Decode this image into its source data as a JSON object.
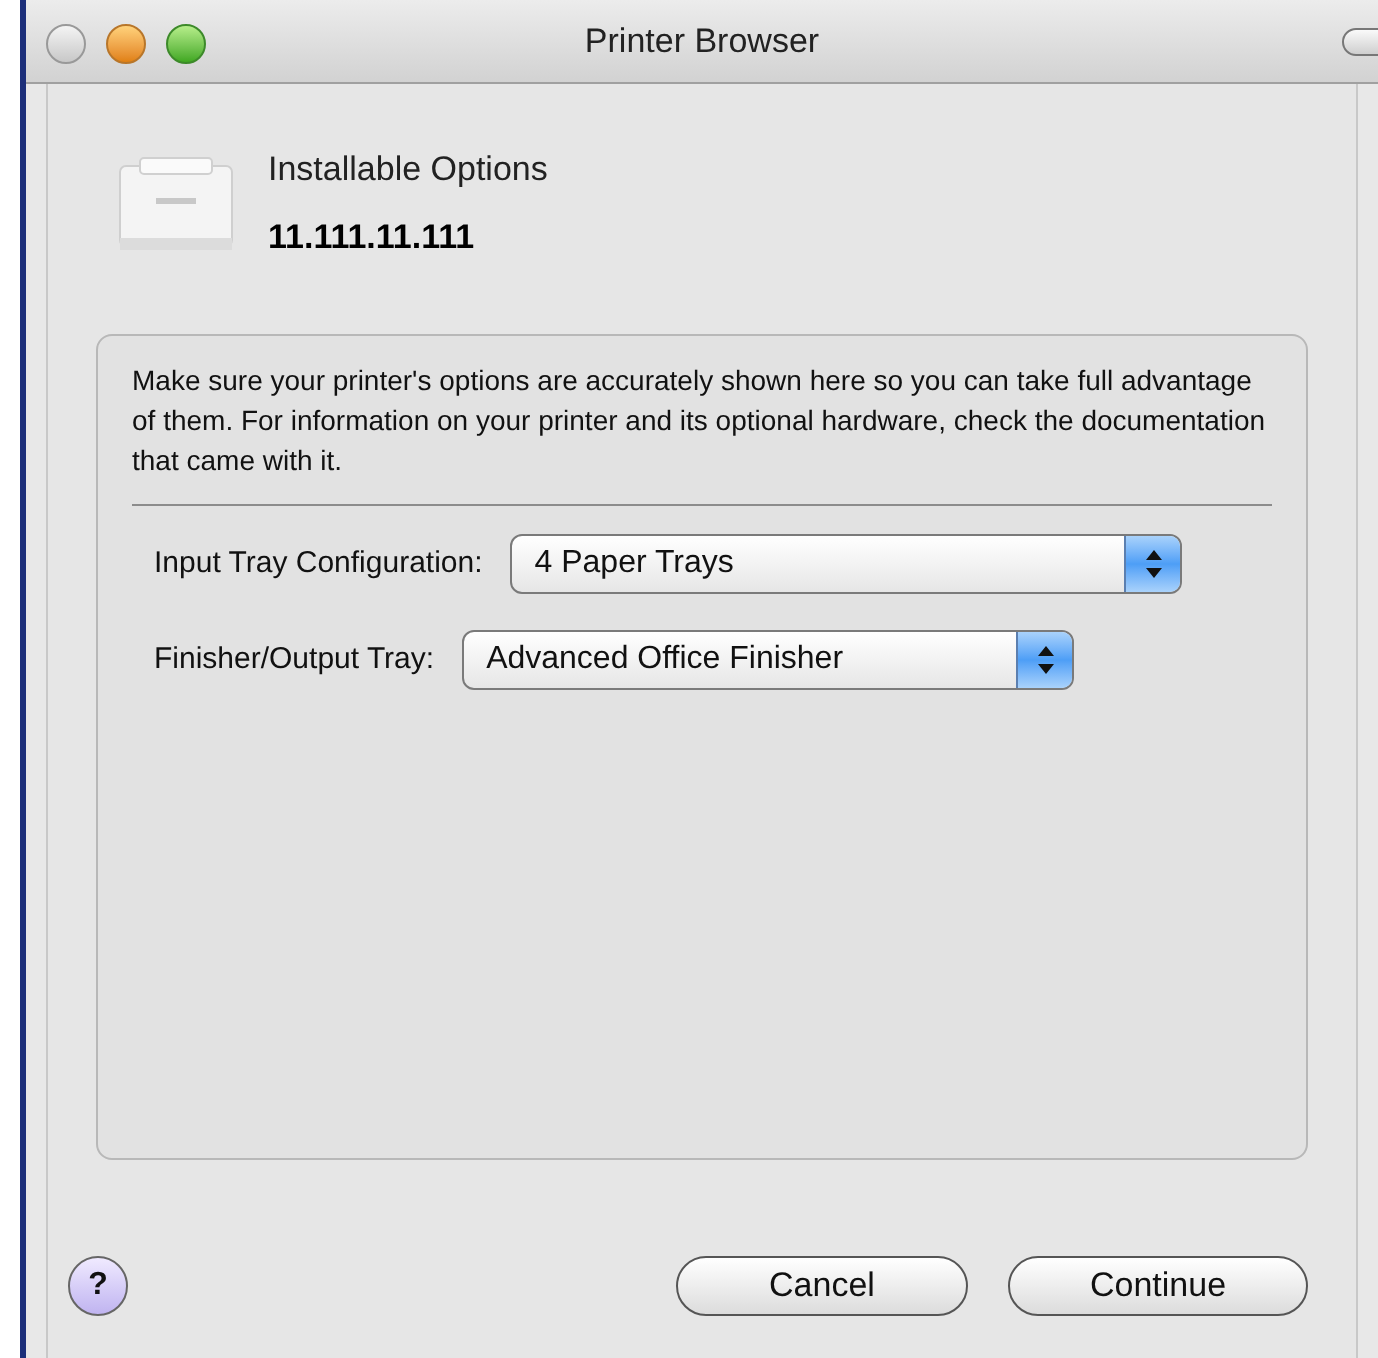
{
  "window": {
    "title": "Printer Browser"
  },
  "header": {
    "title": "Installable Options",
    "address": "11.111.11.111"
  },
  "group": {
    "description": "Make sure your printer's options are accurately shown here so you can take full advantage of them.  For information on your printer and its optional hardware, check the documentation that came with it.",
    "options": [
      {
        "label": "Input Tray Configuration:",
        "value": "4 Paper Trays"
      },
      {
        "label": "Finisher/Output Tray:",
        "value": "Advanced Office Finisher"
      }
    ]
  },
  "buttons": {
    "help": "?",
    "cancel": "Cancel",
    "continue": "Continue"
  }
}
